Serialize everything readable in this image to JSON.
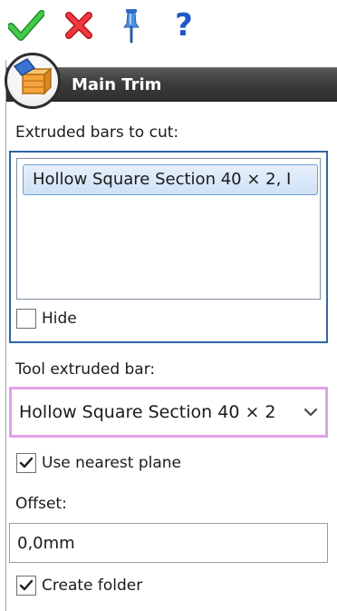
{
  "toolbar": {
    "ok_icon": "checkmark-icon",
    "cancel_icon": "x-icon",
    "pin_icon": "pushpin-icon",
    "help_icon": "question-mark-icon",
    "help_glyph": "?"
  },
  "panel": {
    "title": "Main Trim",
    "icon": "trim-feature-icon"
  },
  "bars_to_cut": {
    "label": "Extruded bars to cut:",
    "items": [
      "Hollow Square Section 40 × 2, I"
    ],
    "hide_label": "Hide",
    "hide_checked": false
  },
  "tool_bar": {
    "label": "Tool extruded bar:",
    "selected": "Hollow Square Section 40 × 2"
  },
  "nearest_plane": {
    "label": "Use nearest plane",
    "checked": true
  },
  "offset": {
    "label": "Offset:",
    "value": "0,0mm"
  },
  "create_folder": {
    "label": "Create folder",
    "checked": true
  },
  "colors": {
    "ok_green": "#2fae35",
    "cancel_red": "#e0252b",
    "pin_blue": "#3d7fd6",
    "help_blue": "#1f56c9",
    "header_dark": "#3d3d3d",
    "selection_border": "#2f66a8",
    "dropdown_border": "#e3a0e6"
  }
}
